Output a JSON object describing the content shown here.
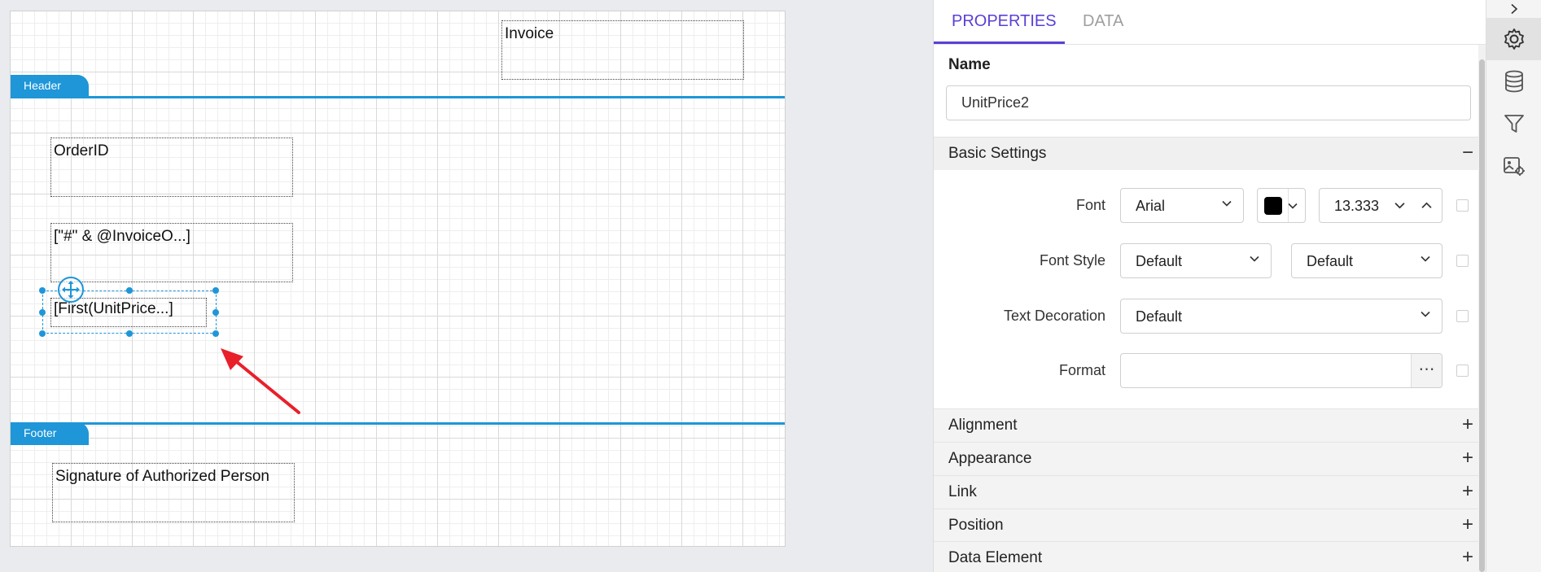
{
  "canvas": {
    "invoice_title": "Invoice",
    "header_band_label": "Header",
    "footer_band_label": "Footer",
    "items": {
      "order_id": "OrderID",
      "invoice_expr": "[\"#\" & @InvoiceO...]",
      "unit_price": "[First(UnitPrice...]",
      "signature": "Signature of Authorized Person"
    },
    "annotation_arrow_color": "#e8202a"
  },
  "panel": {
    "tabs": {
      "properties": "PROPERTIES",
      "data": "DATA"
    },
    "name_label": "Name",
    "name_value": "UnitPrice2",
    "basic_settings": {
      "title": "Basic Settings",
      "toggle": "−",
      "font_label": "Font",
      "font_family": "Arial",
      "font_color": "#000000",
      "font_size": "13.333",
      "font_style_label": "Font Style",
      "font_style": "Default",
      "font_weight": "Default",
      "text_decoration_label": "Text Decoration",
      "text_decoration": "Default",
      "format_label": "Format",
      "format_value": "",
      "format_button": "⋯"
    },
    "sections": [
      {
        "title": "Alignment",
        "toggle": "+"
      },
      {
        "title": "Appearance",
        "toggle": "+"
      },
      {
        "title": "Link",
        "toggle": "+"
      },
      {
        "title": "Position",
        "toggle": "+"
      },
      {
        "title": "Data Element",
        "toggle": "+"
      }
    ]
  },
  "rail": {
    "collapse_icon": "chevron-right-icon",
    "items": [
      "gear-icon",
      "database-icon",
      "filter-icon",
      "image-settings-icon"
    ],
    "active": "gear-icon"
  },
  "colors": {
    "accent": "#5b3fd4",
    "band": "#1e96d8"
  }
}
